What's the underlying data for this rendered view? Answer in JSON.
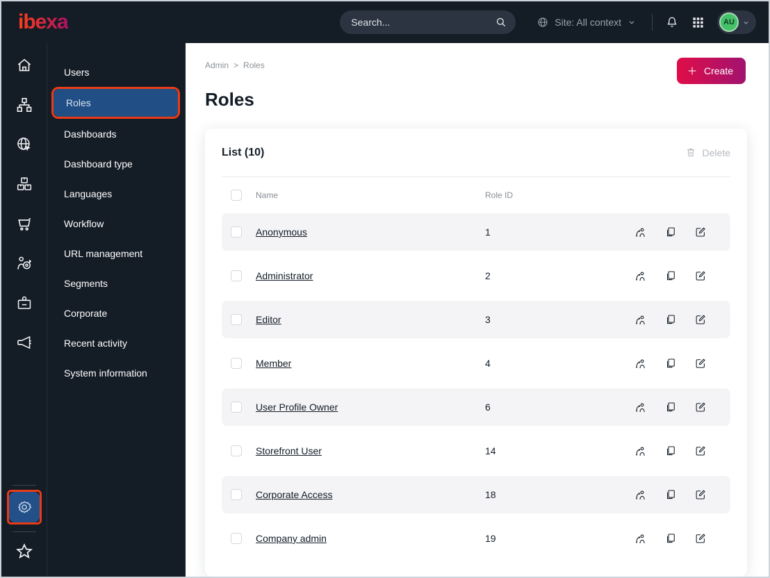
{
  "topbar": {
    "logo_text": "ibexa",
    "search_placeholder": "Search...",
    "site_context_label": "Site: All context",
    "avatar_initials": "AU"
  },
  "iconrail": {
    "items": [
      "home",
      "content-tree",
      "site",
      "products",
      "commerce",
      "customer-targeting",
      "corporate-badge",
      "marketing-megaphone"
    ],
    "bottom": [
      "admin-gear",
      "bookmarks-star"
    ]
  },
  "sidebar": {
    "items": [
      {
        "label": "Users",
        "active": false
      },
      {
        "label": "Roles",
        "active": true
      },
      {
        "label": "Dashboards",
        "active": false
      },
      {
        "label": "Dashboard type",
        "active": false
      },
      {
        "label": "Languages",
        "active": false
      },
      {
        "label": "Workflow",
        "active": false
      },
      {
        "label": "URL management",
        "active": false
      },
      {
        "label": "Segments",
        "active": false
      },
      {
        "label": "Corporate",
        "active": false
      },
      {
        "label": "Recent activity",
        "active": false
      },
      {
        "label": "System information",
        "active": false
      }
    ]
  },
  "main": {
    "breadcrumb": {
      "root": "Admin",
      "separator": ">",
      "current": "Roles"
    },
    "create_label": "Create",
    "page_title": "Roles",
    "list": {
      "title": "List (10)",
      "delete_label": "Delete",
      "columns": {
        "name": "Name",
        "role_id": "Role ID"
      },
      "rows": [
        {
          "name": "Anonymous",
          "role_id": "1"
        },
        {
          "name": "Administrator",
          "role_id": "2"
        },
        {
          "name": "Editor",
          "role_id": "3"
        },
        {
          "name": "Member",
          "role_id": "4"
        },
        {
          "name": "User Profile Owner",
          "role_id": "6"
        },
        {
          "name": "Storefront User",
          "role_id": "14"
        },
        {
          "name": "Corporate Access",
          "role_id": "18"
        },
        {
          "name": "Company admin",
          "role_id": "19"
        }
      ]
    }
  },
  "colors": {
    "topbar_bg": "#141c26",
    "selected_item_blue": "#214e85",
    "annotation_orange": "#ea3b17",
    "create_gradient_start": "#e00d49",
    "create_gradient_end": "#a0136f",
    "avatar_green": "#45c169",
    "row_alt_bg": "#f4f4f6",
    "disabled_gray": "#b4b8bf"
  }
}
